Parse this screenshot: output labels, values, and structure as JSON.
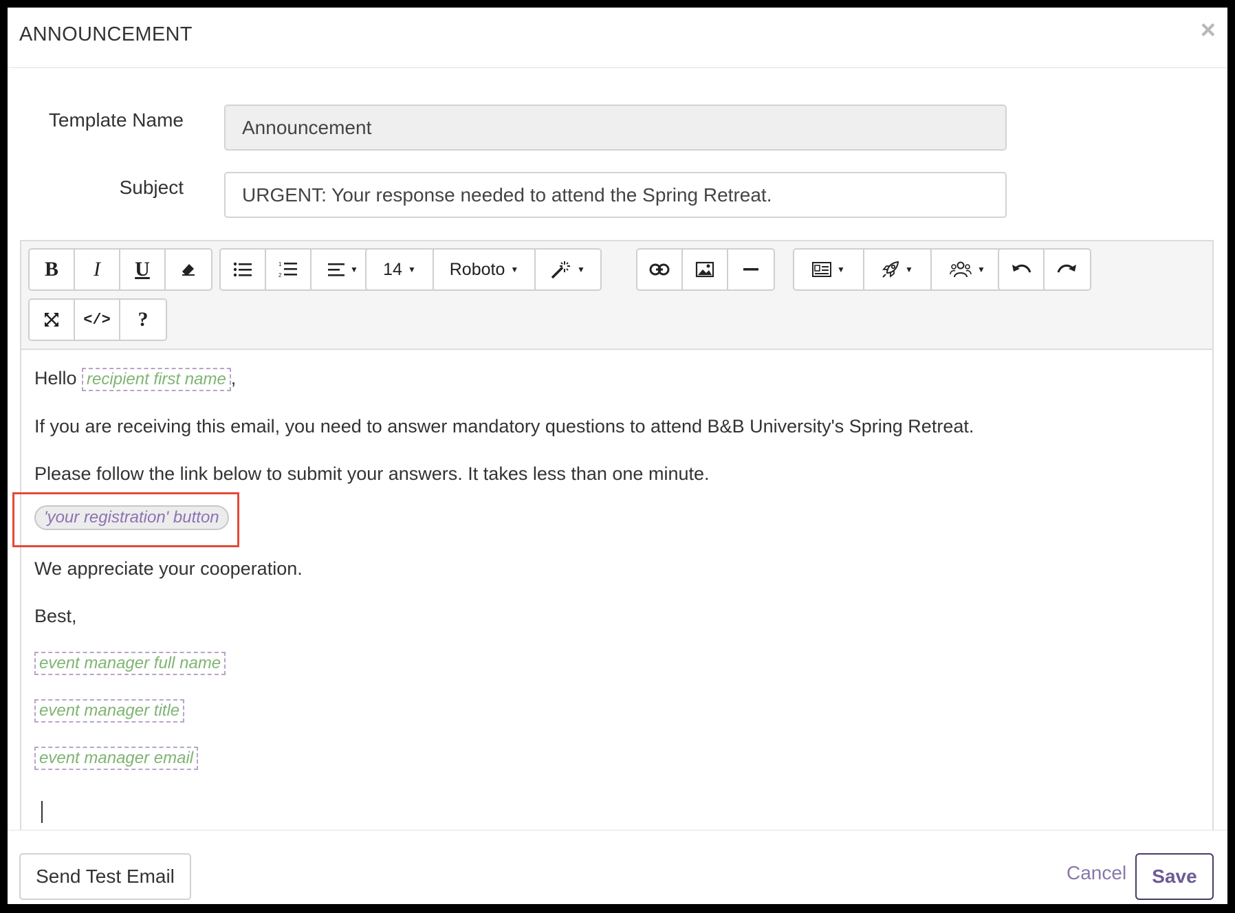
{
  "dialog": {
    "title": "ANNOUNCEMENT",
    "close_symbol": "×"
  },
  "form": {
    "template_name_label": "Template Name",
    "template_name_value": "Announcement",
    "subject_label": "Subject",
    "subject_value": "URGENT: Your response needed to attend the Spring Retreat."
  },
  "toolbar": {
    "font_size": "14",
    "font_family": "Roboto",
    "icons": [
      "bold-icon",
      "italic-icon",
      "underline-icon",
      "eraser-icon",
      "unordered-list-icon",
      "ordered-list-icon",
      "align-icon",
      "font-size-dropdown",
      "font-family-dropdown",
      "magic-wand-icon",
      "link-icon",
      "image-icon",
      "horizontal-rule-icon",
      "contact-card-icon",
      "rocket-icon",
      "people-icon",
      "undo-icon",
      "redo-icon",
      "fullscreen-icon",
      "code-view-icon",
      "help-icon"
    ]
  },
  "body": {
    "greeting": "Hello",
    "recipient_token": "recipient first name",
    "greeting_suffix": ",",
    "paragraph1": "If you are receiving this email, you need to answer mandatory questions to attend B&B University's Spring Retreat.",
    "paragraph2": "Please follow the link below to submit your answers. It takes less than one minute.",
    "registration_button_token": "'your registration' button",
    "paragraph3": "We appreciate your cooperation.",
    "signoff": "Best,",
    "manager_name_token": "event manager full name",
    "manager_title_token": "event manager title",
    "manager_email_token": "event manager email"
  },
  "footer": {
    "send_test_label": "Send Test Email",
    "cancel_label": "Cancel",
    "save_label": "Save"
  },
  "colors": {
    "token_text": "#7fb474",
    "token_border": "#b9a3c9",
    "pill_text": "#8c72b3",
    "highlight": "#e34a37",
    "primary": "#4a3a66"
  }
}
